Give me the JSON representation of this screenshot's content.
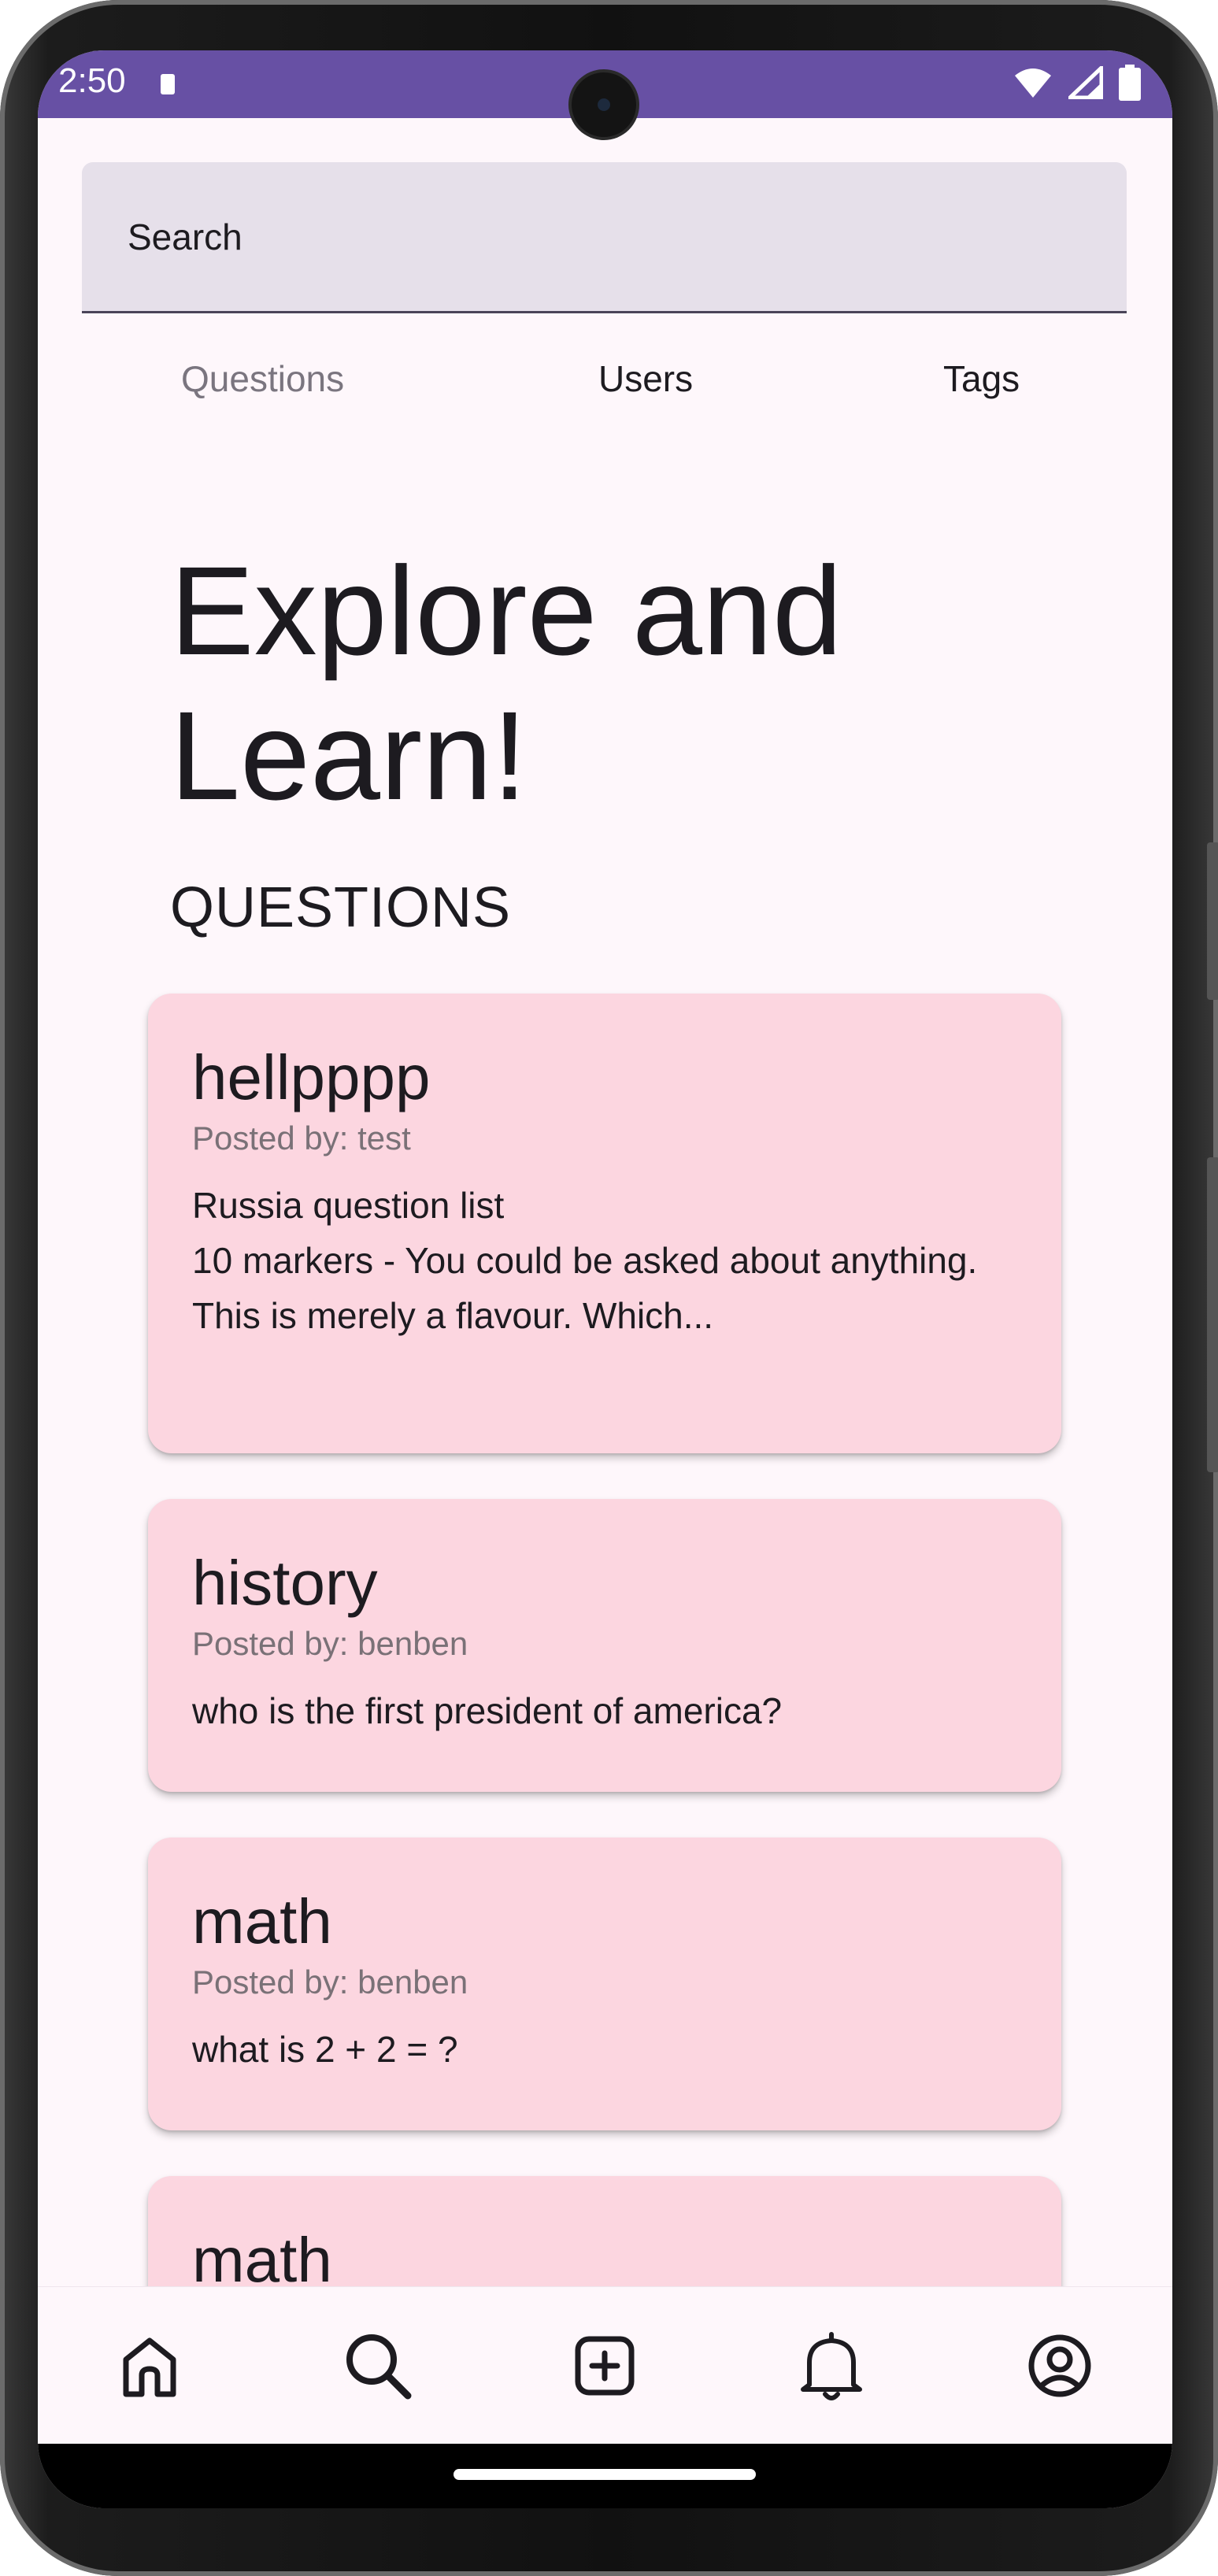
{
  "status_bar": {
    "time": "2:50"
  },
  "search": {
    "placeholder": "Search"
  },
  "tabs": [
    {
      "label": "Questions"
    },
    {
      "label": "Users"
    },
    {
      "label": "Tags"
    }
  ],
  "page": {
    "title": "Explore and Learn!",
    "section_heading": "QUESTIONS"
  },
  "cards": [
    {
      "title": "hellpppp",
      "author": "Posted by: test",
      "body": "Russia question list\n10 markers - You could be asked about anything. This is merely a flavour. Which..."
    },
    {
      "title": "history",
      "author": "Posted by: benben",
      "body": "who is the first president of america?"
    },
    {
      "title": "math",
      "author": "Posted by: benben",
      "body": "what is 2 + 2 = ?"
    },
    {
      "title": "math"
    }
  ],
  "bottom_nav": [
    {
      "icon": "home-icon"
    },
    {
      "icon": "search-icon"
    },
    {
      "icon": "add-box-icon"
    },
    {
      "icon": "bell-icon"
    },
    {
      "icon": "account-icon"
    }
  ],
  "colors": {
    "status_bar": "#6750a4",
    "background": "#fef7fb",
    "card": "#fcd6e0",
    "search_field": "#e6e0ea"
  }
}
